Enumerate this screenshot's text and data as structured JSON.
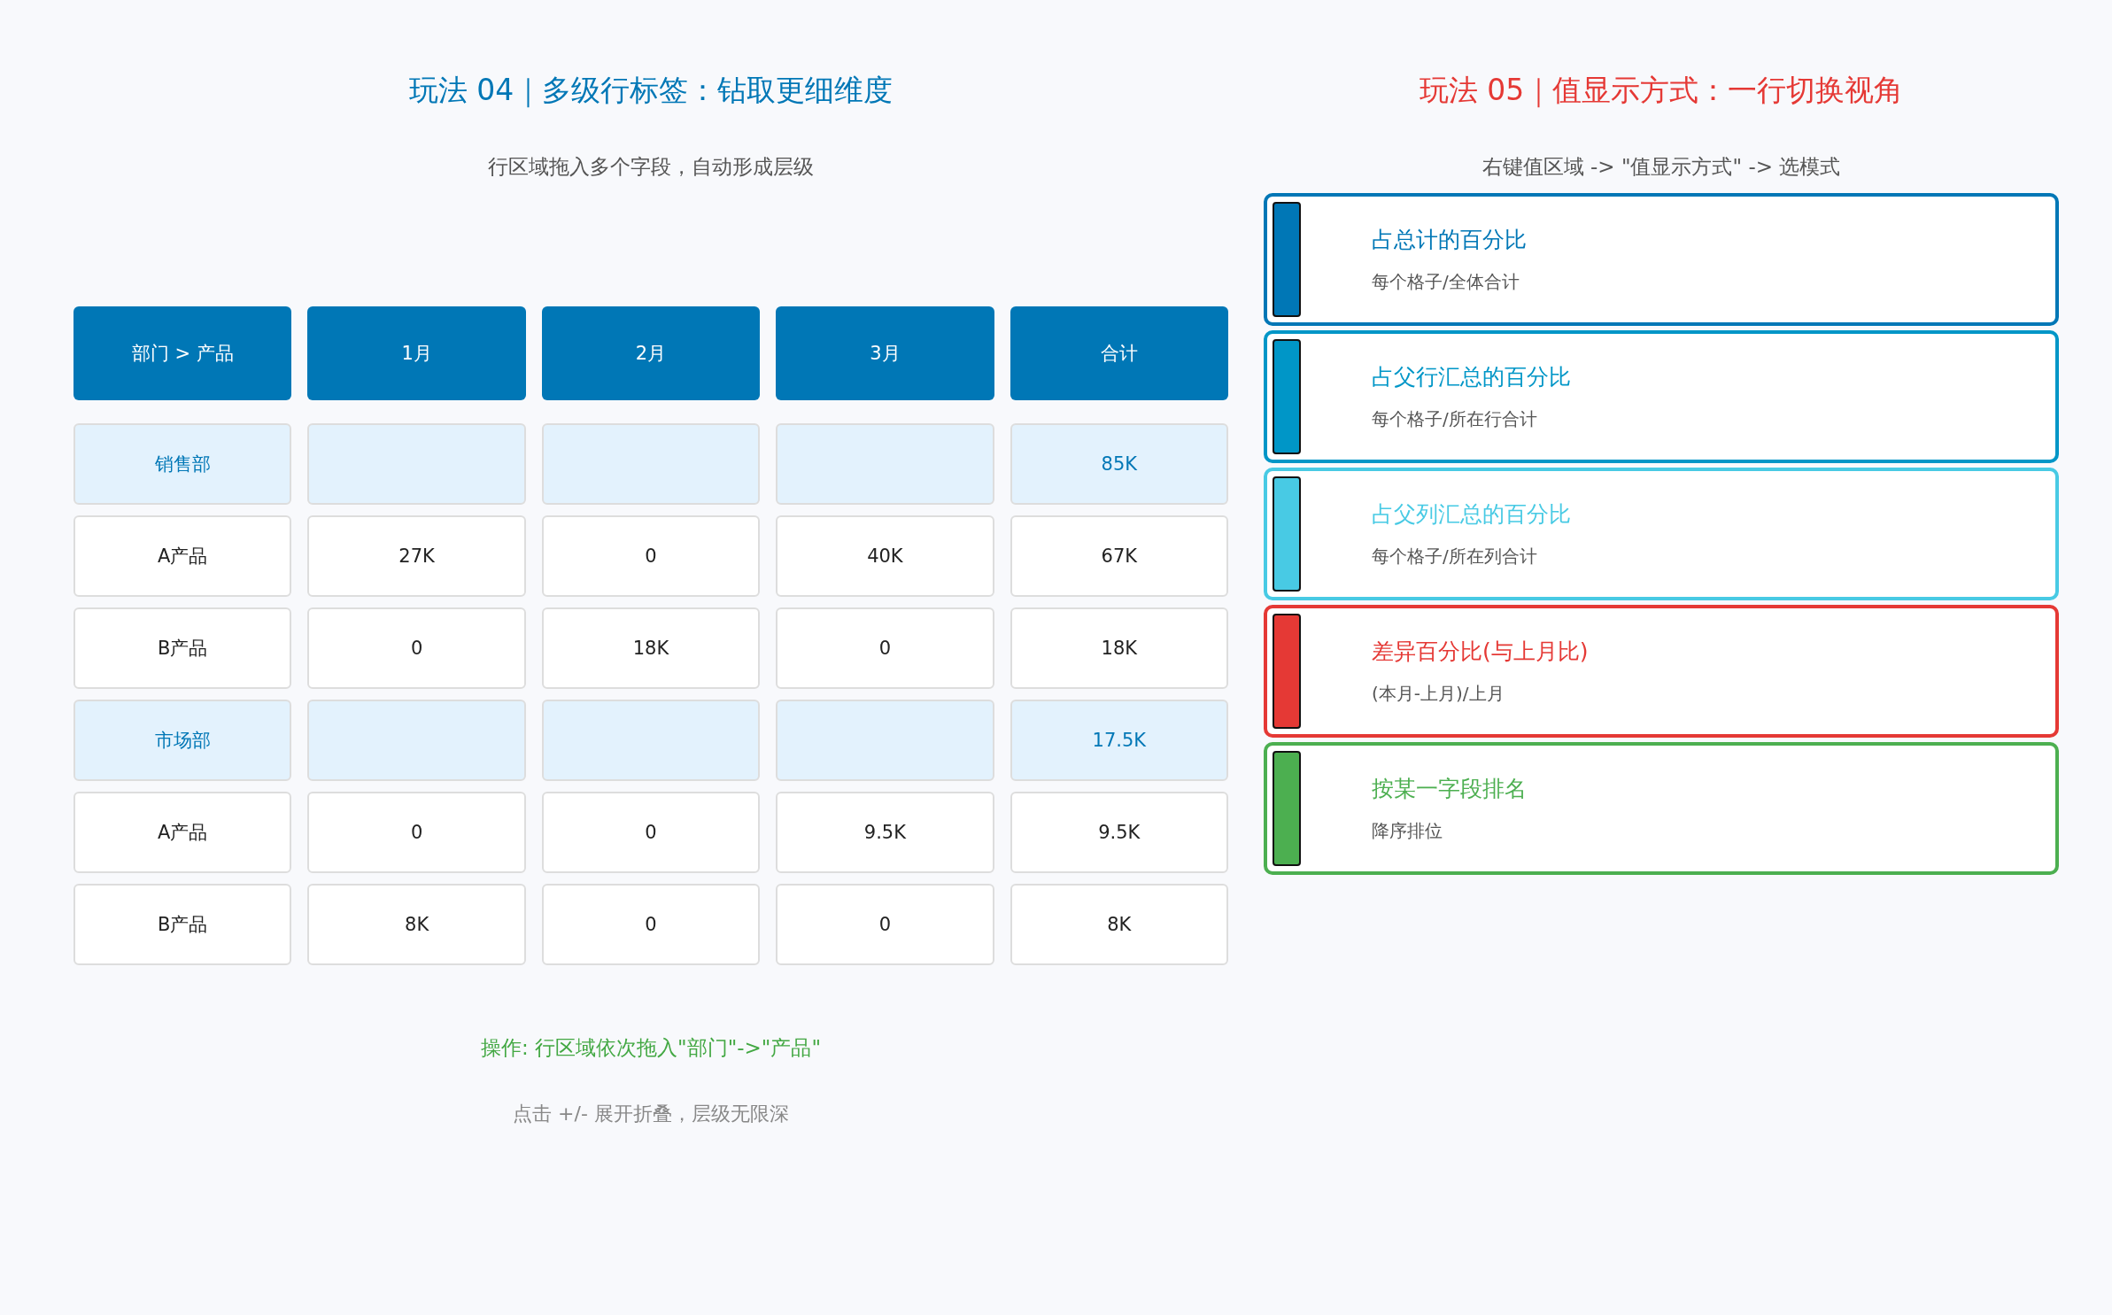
{
  "left": {
    "title": "玩法 04｜多级行标签：钻取更细维度",
    "subtitle": "行区域拖入多个字段，自动形成层级",
    "table": {
      "columns": [
        "部门 > 产品",
        "1月",
        "2月",
        "3月",
        "合计"
      ],
      "rows": [
        {
          "kind": "group",
          "cells": [
            "销售部",
            "",
            "",
            "",
            "85K"
          ]
        },
        {
          "kind": "item",
          "cells": [
            "A产品",
            "27K",
            "0",
            "40K",
            "67K"
          ]
        },
        {
          "kind": "item",
          "cells": [
            "B产品",
            "0",
            "18K",
            "0",
            "18K"
          ]
        },
        {
          "kind": "group",
          "cells": [
            "市场部",
            "",
            "",
            "",
            "17.5K"
          ]
        },
        {
          "kind": "item",
          "cells": [
            "A产品",
            "0",
            "0",
            "9.5K",
            "9.5K"
          ]
        },
        {
          "kind": "item",
          "cells": [
            "B产品",
            "8K",
            "0",
            "0",
            "8K"
          ]
        }
      ]
    },
    "operation": "操作: 行区域依次拖入\"部门\"->\"产品\"",
    "hint": "点击 +/- 展开折叠，层级无限深"
  },
  "right": {
    "title": "玩法 05｜值显示方式：一行切换视角",
    "subtitle": "右键值区域 -> \"值显示方式\" -> 选模式",
    "modes": [
      {
        "title": "占总计的百分比",
        "description": "每个格子/全体合计",
        "color": "#0077b6"
      },
      {
        "title": "占父行汇总的百分比",
        "description": "每个格子/所在行合计",
        "color": "#0096c7"
      },
      {
        "title": "占父列汇总的百分比",
        "description": "每个格子/所在列合计",
        "color": "#48cae4"
      },
      {
        "title": "差异百分比(与上月比)",
        "description": "(本月-上月)/上月",
        "color": "#e53935"
      },
      {
        "title": "按某一字段排名",
        "description": "降序排位",
        "color": "#4caf50"
      }
    ]
  }
}
